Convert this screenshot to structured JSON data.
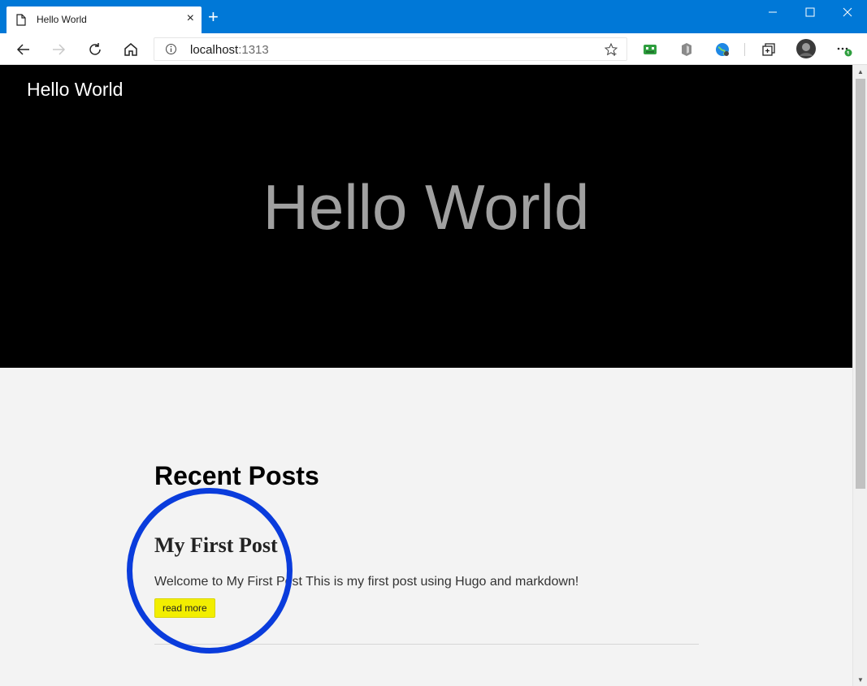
{
  "browser": {
    "tab": {
      "title": "Hello World",
      "close_label": "×"
    },
    "new_tab_label": "+",
    "address": {
      "host": "localhost",
      "port": ":1313"
    }
  },
  "page": {
    "brand": "Hello World",
    "hero_title": "Hello World",
    "recent_heading": "Recent Posts",
    "posts": [
      {
        "title": "My First Post",
        "summary": "Welcome to My First Post This is my first post using Hugo and markdown!",
        "read_more": "read more"
      }
    ]
  },
  "colors": {
    "titlebar": "#0078d7",
    "hero_bg": "#000000",
    "highlight": "#f2ee00",
    "annotation_circle": "#0a3cdc"
  }
}
